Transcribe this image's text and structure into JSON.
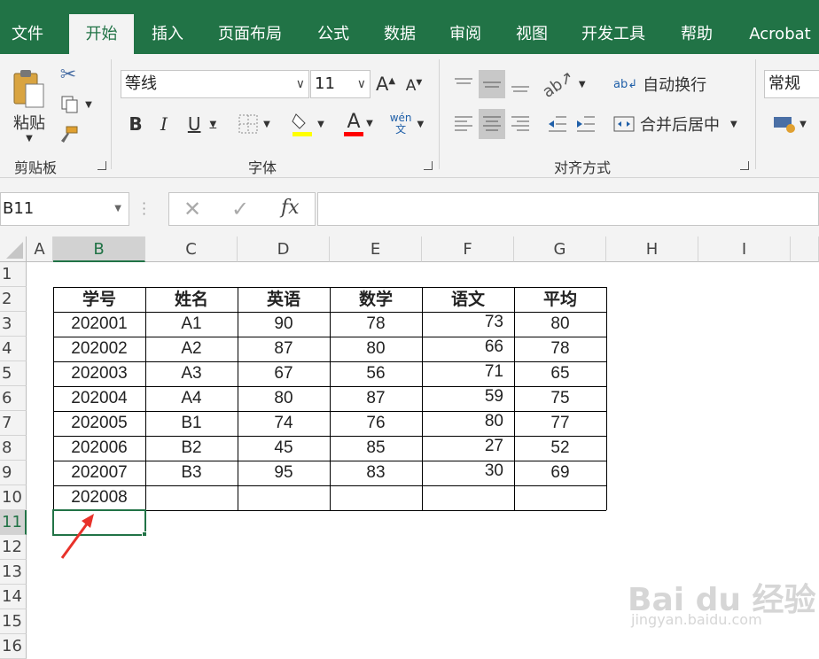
{
  "tabs": [
    {
      "label": "文件"
    },
    {
      "label": "开始"
    },
    {
      "label": "插入"
    },
    {
      "label": "页面布局"
    },
    {
      "label": "公式"
    },
    {
      "label": "数据"
    },
    {
      "label": "审阅"
    },
    {
      "label": "视图"
    },
    {
      "label": "开发工具"
    },
    {
      "label": "帮助"
    },
    {
      "label": "Acrobat"
    }
  ],
  "active_tab": "开始",
  "ribbon": {
    "clipboard": {
      "group_label": "剪贴板",
      "paste_label": "粘贴"
    },
    "font": {
      "group_label": "字体",
      "font_name": "等线",
      "font_size": "11",
      "phonetic_label": "wén\n文"
    },
    "alignment": {
      "group_label": "对齐方式",
      "wrap_text": "自动换行",
      "merge_center": "合并后居中"
    },
    "number": {
      "format": "常规"
    }
  },
  "formula_bar": {
    "name_box": "B11",
    "fx_label": "fx",
    "formula": ""
  },
  "columns": [
    "A",
    "B",
    "C",
    "D",
    "E",
    "F",
    "G",
    "H",
    "I"
  ],
  "rows": [
    "1",
    "2",
    "3",
    "4",
    "5",
    "6",
    "7",
    "8",
    "9",
    "10",
    "11",
    "12",
    "13",
    "14",
    "15",
    "16"
  ],
  "selected_cell": "B11",
  "table": {
    "headers": [
      "学号",
      "姓名",
      "英语",
      "数学",
      "语文",
      "平均"
    ],
    "rows": [
      [
        "202001",
        "A1",
        "90",
        "78",
        "73",
        "80"
      ],
      [
        "202002",
        "A2",
        "87",
        "80",
        "66",
        "78"
      ],
      [
        "202003",
        "A3",
        "67",
        "56",
        "71",
        "65"
      ],
      [
        "202004",
        "A4",
        "80",
        "87",
        "59",
        "75"
      ],
      [
        "202005",
        "B1",
        "74",
        "76",
        "80",
        "77"
      ],
      [
        "202006",
        "B2",
        "45",
        "85",
        "27",
        "52"
      ],
      [
        "202007",
        "B3",
        "95",
        "83",
        "30",
        "69"
      ],
      [
        "202008",
        "",
        "",
        "",
        "",
        ""
      ]
    ]
  },
  "watermark": {
    "brand": "Bai du 经验",
    "url": "jingyan.baidu.com"
  },
  "colors": {
    "excel_green": "#217346",
    "arrow_red": "#e8322a",
    "fill_yellow": "#ffff00",
    "font_red": "#ff0000"
  }
}
